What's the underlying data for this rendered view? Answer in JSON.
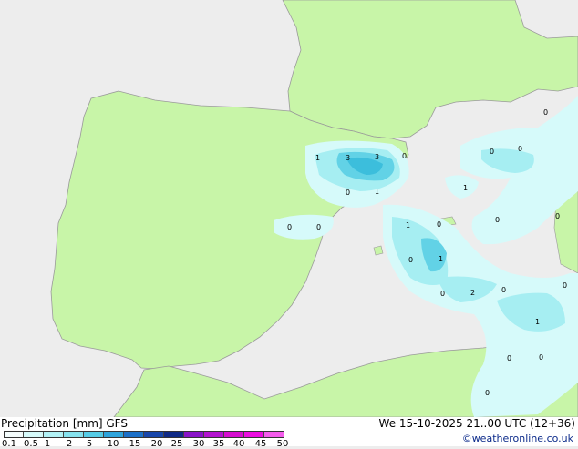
{
  "colors": {
    "sea": "#ededed",
    "land": "#c8f5a8",
    "coast": "#9a9a9a",
    "precip_light": "#d6fafa",
    "precip_mid": "#a6eef2",
    "precip_heavy": "#62d2e6",
    "precip_core": "#3cbedc"
  },
  "map": {
    "contour_labels": [
      "1",
      "3",
      "3",
      "0",
      "0",
      "1",
      "0",
      "0",
      "1",
      "0",
      "0",
      "1",
      "0",
      "2",
      "0",
      "0",
      "1",
      "0",
      "0",
      "1",
      "0",
      "0",
      "0",
      "0",
      "0",
      "0"
    ]
  },
  "footer": {
    "title": "Precipitation [mm]  GFS",
    "timestamp": "We 15-10-2025 21..00 UTC (12+36)",
    "credit": "©weatheronline.co.uk",
    "legend": {
      "ticks": [
        "0.1",
        "0.5",
        "1",
        "2",
        "5",
        "10",
        "15",
        "20",
        "25",
        "30",
        "35",
        "40",
        "45",
        "50"
      ],
      "colors": [
        "#f5fdfd",
        "#d6fafa",
        "#b2f2f6",
        "#86e2ee",
        "#56cce6",
        "#2ea4dc",
        "#1c70c8",
        "#1846aa",
        "#102a86",
        "#8a14c8",
        "#b414d0",
        "#d60ed0",
        "#ec0ee0",
        "#f45cec"
      ]
    }
  }
}
